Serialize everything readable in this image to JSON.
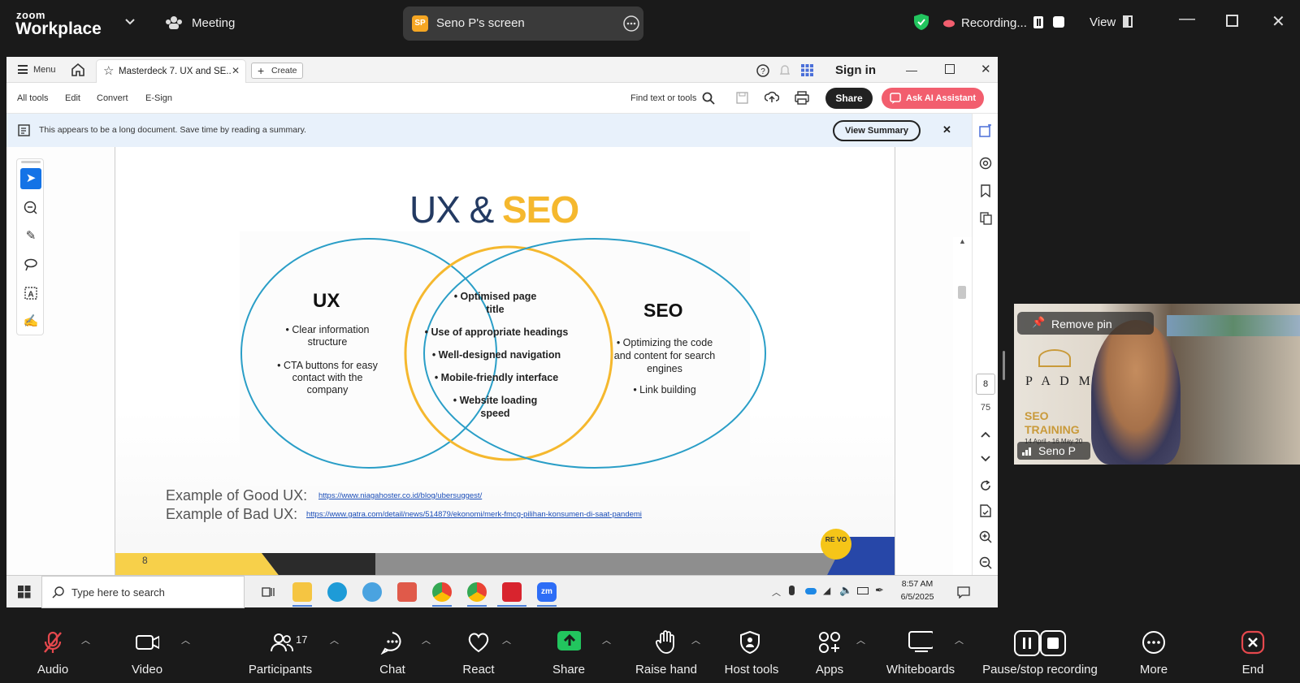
{
  "zoom": {
    "logo_small": "zoom",
    "logo_big": "Workplace",
    "meeting_label": "Meeting",
    "screen_badge": "SP",
    "screen_label": "Seno P's screen",
    "recording_label": "Recording...",
    "view_label": "View"
  },
  "acrobat": {
    "menu_label": "Menu",
    "tab_title": "Masterdeck 7. UX and SE..",
    "create_label": "Create",
    "sign_in": "Sign in",
    "menu_items": [
      "All tools",
      "Edit",
      "Convert",
      "E-Sign"
    ],
    "find_label": "Find text or tools",
    "share_label": "Share",
    "ai_label": "Ask AI Assistant",
    "banner_text": "This appears to be a long document. Save time by reading a summary.",
    "view_summary": "View Summary",
    "page_current": "8",
    "page_total": "75"
  },
  "slide": {
    "title_ux": "UX &",
    "title_seo": "SEO",
    "ux_heading": "UX",
    "ux_items": [
      "• Clear information structure",
      "• CTA buttons for easy contact with the company"
    ],
    "mid_items": [
      "• Optimised page title",
      "• Use of appropriate headings",
      "• Well-designed navigation",
      "• Mobile-friendly interface",
      "• Website loading speed"
    ],
    "seo_heading": "SEO",
    "seo_items": [
      "• Optimizing the code and content for search engines",
      "• Link building"
    ],
    "good_label": "Example of Good UX:",
    "good_url": "https://www.niagahoster.co.id/blog/ubersuggest/",
    "bad_label": "Example of Bad UX:",
    "bad_url": "https://www.gatra.com/detail/news/514879/ekonomi/merk-fmcg-pilihan-konsumen-di-saat-pandemi",
    "page_number": "8",
    "badge_text": "RE VO"
  },
  "taskbar": {
    "search_placeholder": "Type here to search",
    "time": "8:57 AM",
    "date": "6/5/2025",
    "zoom_icon": "zm"
  },
  "video": {
    "remove_pin": "Remove pin",
    "name": "Seno P",
    "bg_brand": "P A D M",
    "bg_title1": "SEO",
    "bg_title2": "TRAINING",
    "bg_dates": "14 April - 16 May 20"
  },
  "controls": {
    "audio": "Audio",
    "video": "Video",
    "participants": "Participants",
    "participants_count": "17",
    "chat": "Chat",
    "react": "React",
    "share": "Share",
    "raise_hand": "Raise hand",
    "host_tools": "Host tools",
    "apps": "Apps",
    "whiteboards": "Whiteboards",
    "pause_stop": "Pause/stop recording",
    "more": "More",
    "end": "End"
  },
  "colors": {
    "seo_yellow": "#f5b82e",
    "ux_blue": "#2a9ec7",
    "end_red": "#e5484d",
    "share_green": "#22c55e"
  }
}
